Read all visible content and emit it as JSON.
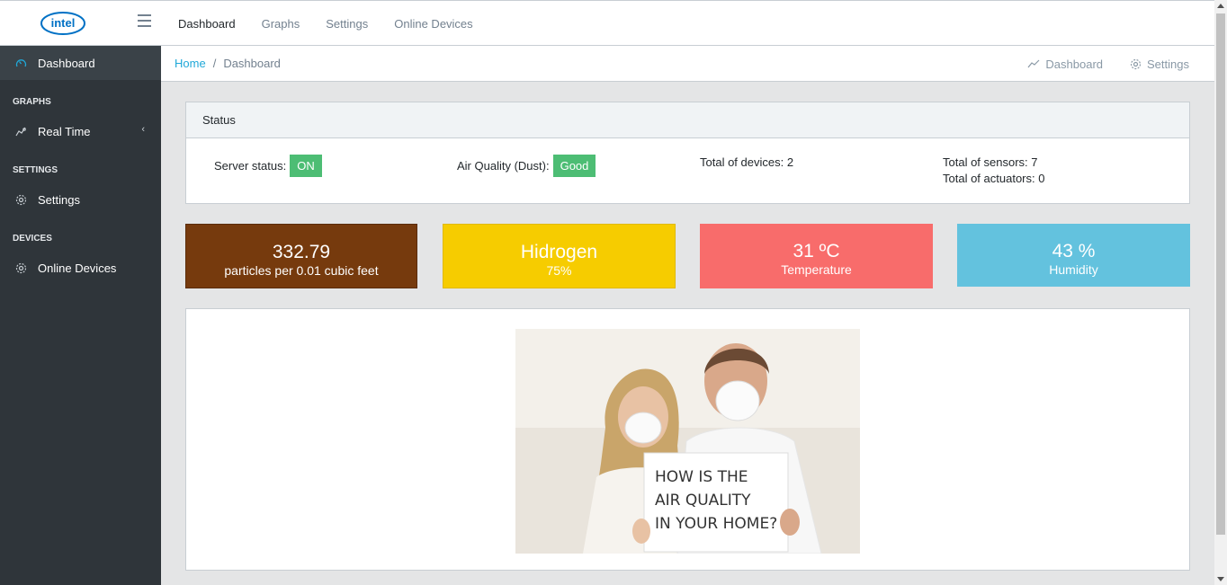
{
  "brand": {
    "logo_text": "intel",
    "logo_color": "#0071c5"
  },
  "topnav": [
    {
      "label": "Dashboard",
      "active": true
    },
    {
      "label": "Graphs"
    },
    {
      "label": "Settings"
    },
    {
      "label": "Online Devices"
    }
  ],
  "sidebar": {
    "dashboard": "Dashboard",
    "graphs_title": "GRAPHS",
    "realtime": "Real Time",
    "settings_title": "SETTINGS",
    "settings": "Settings",
    "devices_title": "DEVICES",
    "online_devices": "Online Devices"
  },
  "breadcrumb": {
    "home": "Home",
    "separator": "/",
    "current": "Dashboard",
    "menu_dashboard": "Dashboard",
    "menu_settings": "Settings"
  },
  "status": {
    "title": "Status",
    "server_label": "Server status:",
    "server_value": "ON",
    "air_label": "Air Quality (Dust):",
    "air_value": "Good",
    "devices": "Total of devices: 2",
    "sensors": "Total of sensors: 7",
    "actuators": "Total of actuators: 0",
    "badge_color": "#4dbd74"
  },
  "tiles": [
    {
      "value": "332.79",
      "label": "particles per 0.01 cubic feet",
      "color": "#763a0d"
    },
    {
      "value": "Hidrogen",
      "label": "75%",
      "color": "#f6cc00"
    },
    {
      "value": "31 ºC",
      "label": "Temperature",
      "color": "#f86c6b"
    },
    {
      "value": "43 %",
      "label": "Humidity",
      "color": "#63c2de"
    }
  ],
  "image": {
    "sign_line1": "HOW IS THE",
    "sign_line2": "AIR QUALITY",
    "sign_line3": "IN YOUR HOME?"
  }
}
